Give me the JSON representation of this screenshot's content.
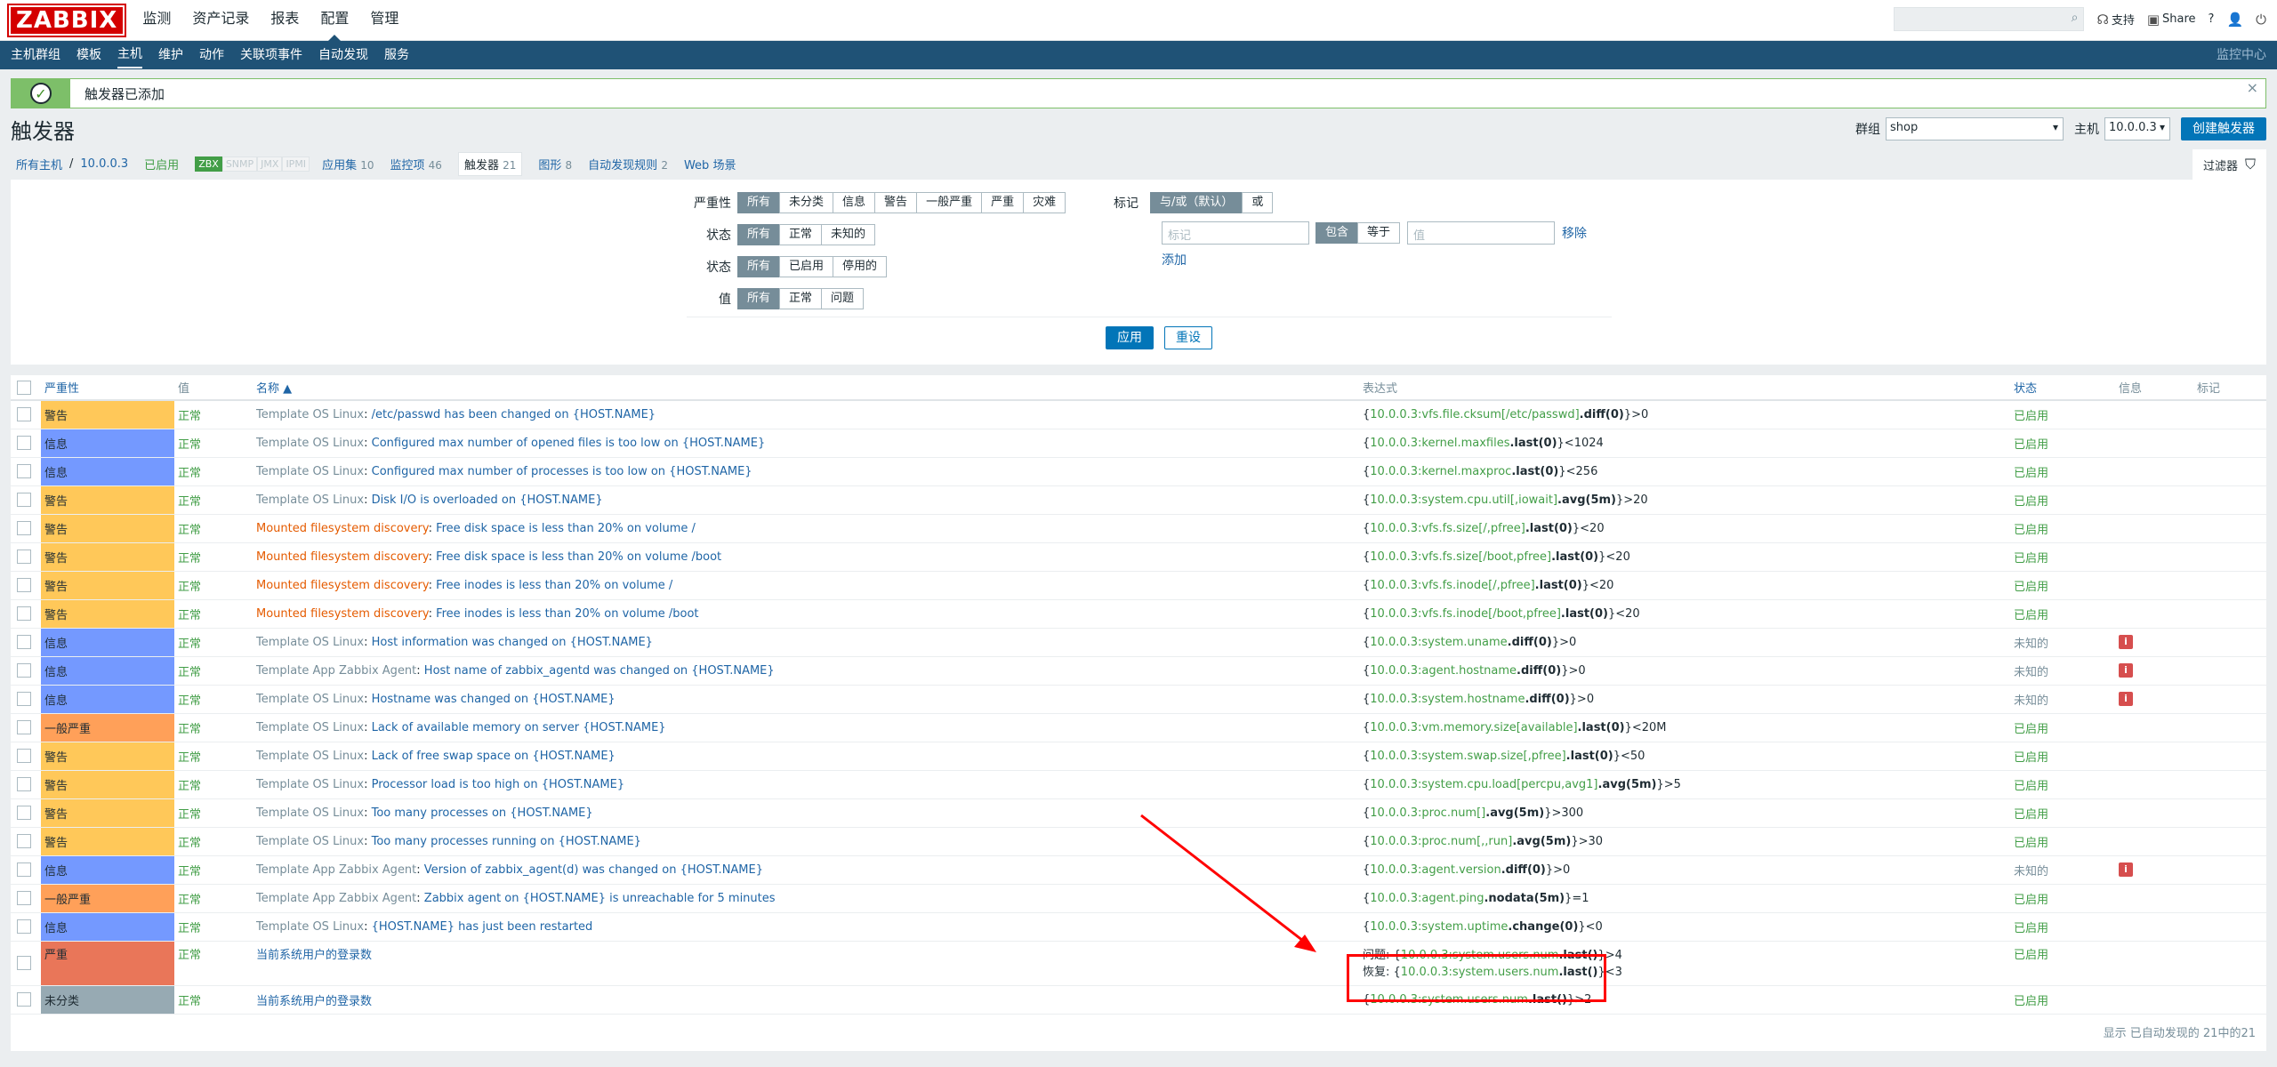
{
  "top": {
    "logo": "ZABBIX",
    "nav": [
      "监测",
      "资产记录",
      "报表",
      "配置",
      "管理"
    ],
    "active": "配置",
    "support": "支持",
    "share": "Share",
    "help": "?"
  },
  "sub": {
    "nav": [
      "主机群组",
      "模板",
      "主机",
      "维护",
      "动作",
      "关联项事件",
      "自动发现",
      "服务"
    ],
    "active": "主机",
    "right": "监控中心"
  },
  "message": "触发器已添加",
  "page": {
    "title": "触发器",
    "group_label": "群组",
    "group_value": "shop",
    "host_label": "主机",
    "host_value": "10.0.0.3",
    "create_btn": "创建触发器"
  },
  "tabs": {
    "all_hosts": "所有主机",
    "sep": "/",
    "host": "10.0.0.3",
    "enabled": "已启用",
    "avail": [
      "ZBX",
      "SNMP",
      "JMX",
      "IPMI"
    ],
    "apps": "应用集",
    "apps_n": "10",
    "items": "监控项",
    "items_n": "46",
    "triggers": "触发器",
    "triggers_n": "21",
    "graphs": "图形",
    "graphs_n": "8",
    "discovery": "自动发现规则",
    "discovery_n": "2",
    "web": "Web 场景",
    "filter": "过滤器"
  },
  "filter": {
    "severity_label": "严重性",
    "severity": [
      "所有",
      "未分类",
      "信息",
      "警告",
      "一般严重",
      "严重",
      "灾难"
    ],
    "state_label": "状态",
    "state": [
      "所有",
      "正常",
      "未知的"
    ],
    "status_label": "状态",
    "status": [
      "所有",
      "已启用",
      "停用的"
    ],
    "value_label": "值",
    "value": [
      "所有",
      "正常",
      "问题"
    ],
    "tags_label": "标记",
    "tags_mode": [
      "与/或（默认）",
      "或"
    ],
    "tag_placeholder": "标记",
    "tag_ops": [
      "包含",
      "等于"
    ],
    "value_placeholder": "值",
    "remove": "移除",
    "add": "添加",
    "apply": "应用",
    "reset": "重设"
  },
  "table": {
    "headers": {
      "severity": "严重性",
      "value": "值",
      "name": "名称 ▲",
      "expression": "表达式",
      "status": "状态",
      "info": "信息",
      "tags": "标记"
    },
    "rows": [
      {
        "sev": "警告",
        "color": "#ffc859",
        "val": "正常",
        "prefix": "Template OS Linux",
        "ptype": "t",
        "name": "/etc/passwd has been changed on {HOST.NAME}",
        "e1": "{",
        "ek": "10.0.0.3:vfs.file.cksum[/etc/passwd]",
        "ef": ".diff(0)",
        "er": "}>0",
        "status": "已启用",
        "info": false
      },
      {
        "sev": "信息",
        "color": "#7499ff",
        "val": "正常",
        "prefix": "Template OS Linux",
        "ptype": "t",
        "name": "Configured max number of opened files is too low on {HOST.NAME}",
        "e1": "{",
        "ek": "10.0.0.3:kernel.maxfiles",
        "ef": ".last(0)",
        "er": "}<1024",
        "status": "已启用",
        "info": false
      },
      {
        "sev": "信息",
        "color": "#7499ff",
        "val": "正常",
        "prefix": "Template OS Linux",
        "ptype": "t",
        "name": "Configured max number of processes is too low on {HOST.NAME}",
        "e1": "{",
        "ek": "10.0.0.3:kernel.maxproc",
        "ef": ".last(0)",
        "er": "}<256",
        "status": "已启用",
        "info": false
      },
      {
        "sev": "警告",
        "color": "#ffc859",
        "val": "正常",
        "prefix": "Template OS Linux",
        "ptype": "t",
        "name": "Disk I/O is overloaded on {HOST.NAME}",
        "e1": "{",
        "ek": "10.0.0.3:system.cpu.util[,iowait]",
        "ef": ".avg(5m)",
        "er": "}>20",
        "status": "已启用",
        "info": false
      },
      {
        "sev": "警告",
        "color": "#ffc859",
        "val": "正常",
        "prefix": "Mounted filesystem discovery",
        "ptype": "d",
        "name": "Free disk space is less than 20% on volume /",
        "e1": "{",
        "ek": "10.0.0.3:vfs.fs.size[/,pfree]",
        "ef": ".last(0)",
        "er": "}<20",
        "status": "已启用",
        "info": false
      },
      {
        "sev": "警告",
        "color": "#ffc859",
        "val": "正常",
        "prefix": "Mounted filesystem discovery",
        "ptype": "d",
        "name": "Free disk space is less than 20% on volume /boot",
        "e1": "{",
        "ek": "10.0.0.3:vfs.fs.size[/boot,pfree]",
        "ef": ".last(0)",
        "er": "}<20",
        "status": "已启用",
        "info": false
      },
      {
        "sev": "警告",
        "color": "#ffc859",
        "val": "正常",
        "prefix": "Mounted filesystem discovery",
        "ptype": "d",
        "name": "Free inodes is less than 20% on volume /",
        "e1": "{",
        "ek": "10.0.0.3:vfs.fs.inode[/,pfree]",
        "ef": ".last(0)",
        "er": "}<20",
        "status": "已启用",
        "info": false
      },
      {
        "sev": "警告",
        "color": "#ffc859",
        "val": "正常",
        "prefix": "Mounted filesystem discovery",
        "ptype": "d",
        "name": "Free inodes is less than 20% on volume /boot",
        "e1": "{",
        "ek": "10.0.0.3:vfs.fs.inode[/boot,pfree]",
        "ef": ".last(0)",
        "er": "}<20",
        "status": "已启用",
        "info": false
      },
      {
        "sev": "信息",
        "color": "#7499ff",
        "val": "正常",
        "prefix": "Template OS Linux",
        "ptype": "t",
        "name": "Host information was changed on {HOST.NAME}",
        "e1": "{",
        "ek": "10.0.0.3:system.uname",
        "ef": ".diff(0)",
        "er": "}>0",
        "status": "未知的",
        "info": true
      },
      {
        "sev": "信息",
        "color": "#7499ff",
        "val": "正常",
        "prefix": "Template App Zabbix Agent",
        "ptype": "t",
        "name": "Host name of zabbix_agentd was changed on {HOST.NAME}",
        "e1": "{",
        "ek": "10.0.0.3:agent.hostname",
        "ef": ".diff(0)",
        "er": "}>0",
        "status": "未知的",
        "info": true
      },
      {
        "sev": "信息",
        "color": "#7499ff",
        "val": "正常",
        "prefix": "Template OS Linux",
        "ptype": "t",
        "name": "Hostname was changed on {HOST.NAME}",
        "e1": "{",
        "ek": "10.0.0.3:system.hostname",
        "ef": ".diff(0)",
        "er": "}>0",
        "status": "未知的",
        "info": true
      },
      {
        "sev": "一般严重",
        "color": "#ffa059",
        "val": "正常",
        "prefix": "Template OS Linux",
        "ptype": "t",
        "name": "Lack of available memory on server {HOST.NAME}",
        "e1": "{",
        "ek": "10.0.0.3:vm.memory.size[available]",
        "ef": ".last(0)",
        "er": "}<20M",
        "status": "已启用",
        "info": false
      },
      {
        "sev": "警告",
        "color": "#ffc859",
        "val": "正常",
        "prefix": "Template OS Linux",
        "ptype": "t",
        "name": "Lack of free swap space on {HOST.NAME}",
        "e1": "{",
        "ek": "10.0.0.3:system.swap.size[,pfree]",
        "ef": ".last(0)",
        "er": "}<50",
        "status": "已启用",
        "info": false
      },
      {
        "sev": "警告",
        "color": "#ffc859",
        "val": "正常",
        "prefix": "Template OS Linux",
        "ptype": "t",
        "name": "Processor load is too high on {HOST.NAME}",
        "e1": "{",
        "ek": "10.0.0.3:system.cpu.load[percpu,avg1]",
        "ef": ".avg(5m)",
        "er": "}>5",
        "status": "已启用",
        "info": false
      },
      {
        "sev": "警告",
        "color": "#ffc859",
        "val": "正常",
        "prefix": "Template OS Linux",
        "ptype": "t",
        "name": "Too many processes on {HOST.NAME}",
        "e1": "{",
        "ek": "10.0.0.3:proc.num[]",
        "ef": ".avg(5m)",
        "er": "}>300",
        "status": "已启用",
        "info": false
      },
      {
        "sev": "警告",
        "color": "#ffc859",
        "val": "正常",
        "prefix": "Template OS Linux",
        "ptype": "t",
        "name": "Too many processes running on {HOST.NAME}",
        "e1": "{",
        "ek": "10.0.0.3:proc.num[,,run]",
        "ef": ".avg(5m)",
        "er": "}>30",
        "status": "已启用",
        "info": false
      },
      {
        "sev": "信息",
        "color": "#7499ff",
        "val": "正常",
        "prefix": "Template App Zabbix Agent",
        "ptype": "t",
        "name": "Version of zabbix_agent(d) was changed on {HOST.NAME}",
        "e1": "{",
        "ek": "10.0.0.3:agent.version",
        "ef": ".diff(0)",
        "er": "}>0",
        "status": "未知的",
        "info": true
      },
      {
        "sev": "一般严重",
        "color": "#ffa059",
        "val": "正常",
        "prefix": "Template App Zabbix Agent",
        "ptype": "t",
        "name": "Zabbix agent on {HOST.NAME} is unreachable for 5 minutes",
        "e1": "{",
        "ek": "10.0.0.3:agent.ping",
        "ef": ".nodata(5m)",
        "er": "}=1",
        "status": "已启用",
        "info": false
      },
      {
        "sev": "信息",
        "color": "#7499ff",
        "val": "正常",
        "prefix": "Template OS Linux",
        "ptype": "t",
        "name": "{HOST.NAME} has just been restarted",
        "e1": "{",
        "ek": "10.0.0.3:system.uptime",
        "ef": ".change(0)",
        "er": "}<0",
        "status": "已启用",
        "info": false
      },
      {
        "sev": "严重",
        "color": "#e97659",
        "val": "正常",
        "prefix": "",
        "ptype": "",
        "name": "当前系统用户的登录数",
        "multi": true,
        "l1": "问题: {",
        "k1": "10.0.0.3:system.users.num",
        "f1": ".last()",
        "r1": "}>4",
        "l2": "恢复: {",
        "k2": "10.0.0.3:system.users.num",
        "f2": ".last()",
        "r2": "}<3",
        "status": "已启用",
        "info": false
      },
      {
        "sev": "未分类",
        "color": "#97aab3",
        "val": "正常",
        "prefix": "",
        "ptype": "",
        "name": "当前系统用户的登录数",
        "e1": "{",
        "ek": "10.0.0.3:system.users.num",
        "ef": ".last()",
        "er": "}>2",
        "status": "已启用",
        "info": false
      }
    ]
  },
  "footer": "显示 已自动发现的 21中的21",
  "info_icon": "i"
}
